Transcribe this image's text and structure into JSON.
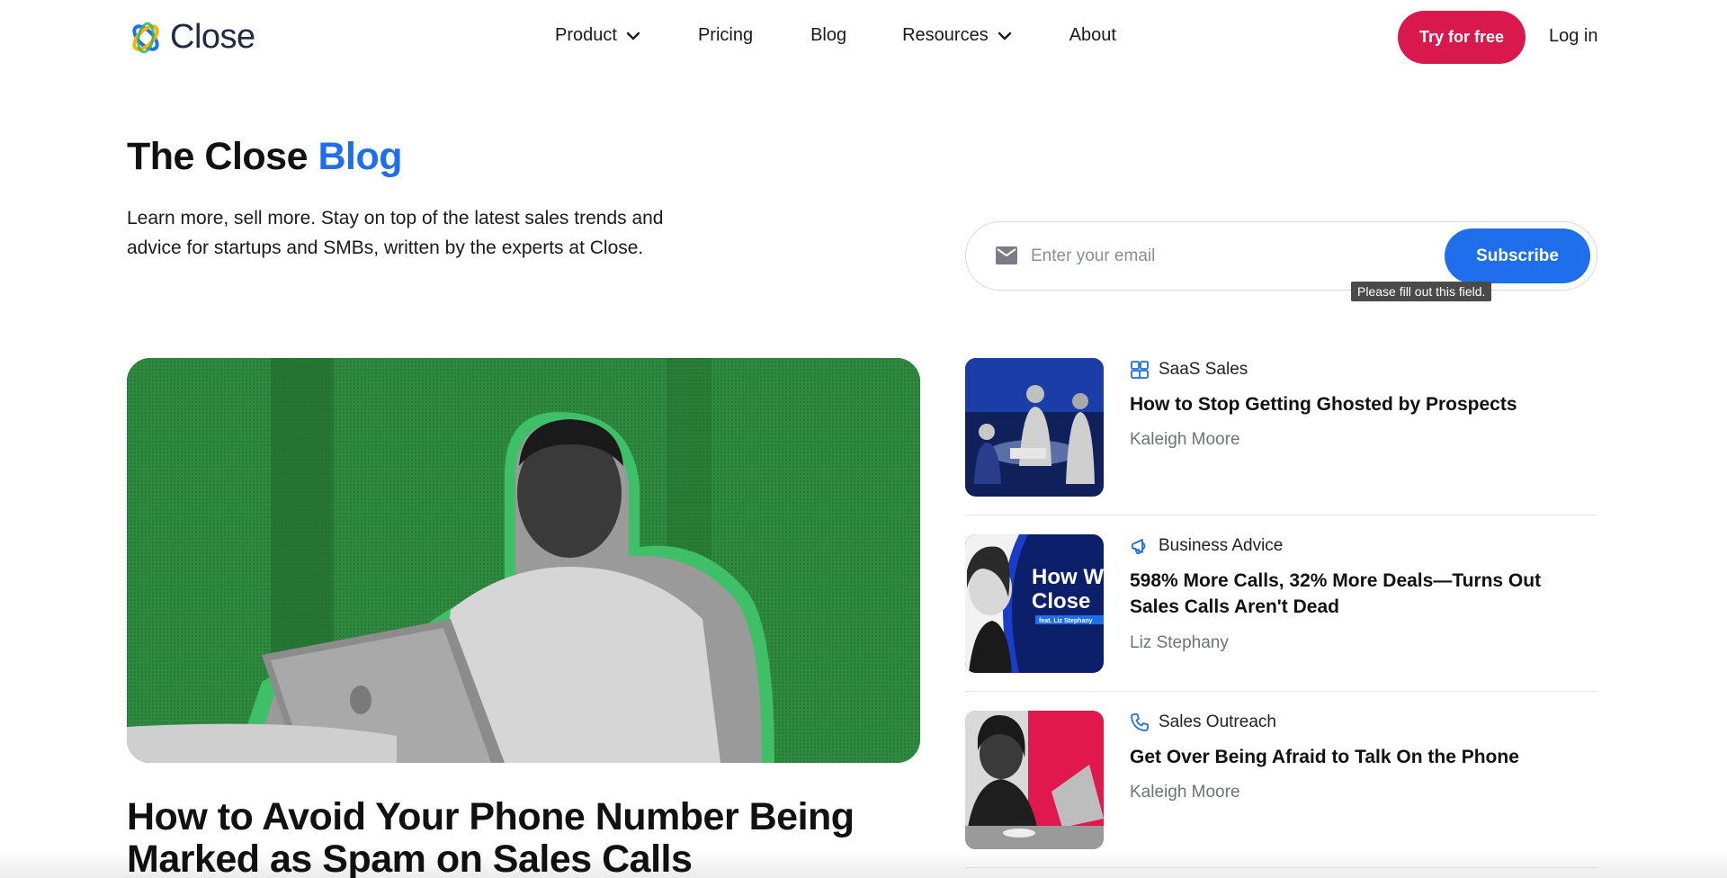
{
  "header": {
    "logo_text": "Close",
    "nav": [
      {
        "label": "Product",
        "has_dropdown": true
      },
      {
        "label": "Pricing",
        "has_dropdown": false
      },
      {
        "label": "Blog",
        "has_dropdown": false
      },
      {
        "label": "Resources",
        "has_dropdown": true
      },
      {
        "label": "About",
        "has_dropdown": false
      }
    ],
    "try_label": "Try for free",
    "login_label": "Log in"
  },
  "intro": {
    "title_main": "The Close ",
    "title_accent": "Blog",
    "description": "Learn more, sell more. Stay on top of the latest sales trends and advice for startups and SMBs, written by the experts at Close."
  },
  "subscribe": {
    "placeholder": "Enter your email",
    "button_label": "Subscribe",
    "tooltip": "Please fill out this field."
  },
  "featured": {
    "title": "How to Avoid Your Phone Number Being Marked as Spam on Sales Calls"
  },
  "posts": [
    {
      "category": "SaaS Sales",
      "category_icon": "grid-icon",
      "title": "How to Stop Getting Ghosted by Prospects",
      "author": "Kaleigh Moore"
    },
    {
      "category": "Business Advice",
      "category_icon": "megaphone-icon",
      "title": "598% More Calls, 32% More Deals—Turns Out Sales Calls Aren't Dead",
      "author": "Liz Stephany",
      "thumb_text_1": "How W",
      "thumb_text_2": "Close",
      "thumb_caption": "feat. Liz Stephany"
    },
    {
      "category": "Sales Outreach",
      "category_icon": "phone-icon",
      "title": "Get Over Being Afraid to Talk On the Phone",
      "author": "Kaleigh Moore"
    }
  ],
  "colors": {
    "accent_blue": "#1f6fec",
    "try_red": "#d9184e",
    "feature_green": "#2f8a3f"
  }
}
